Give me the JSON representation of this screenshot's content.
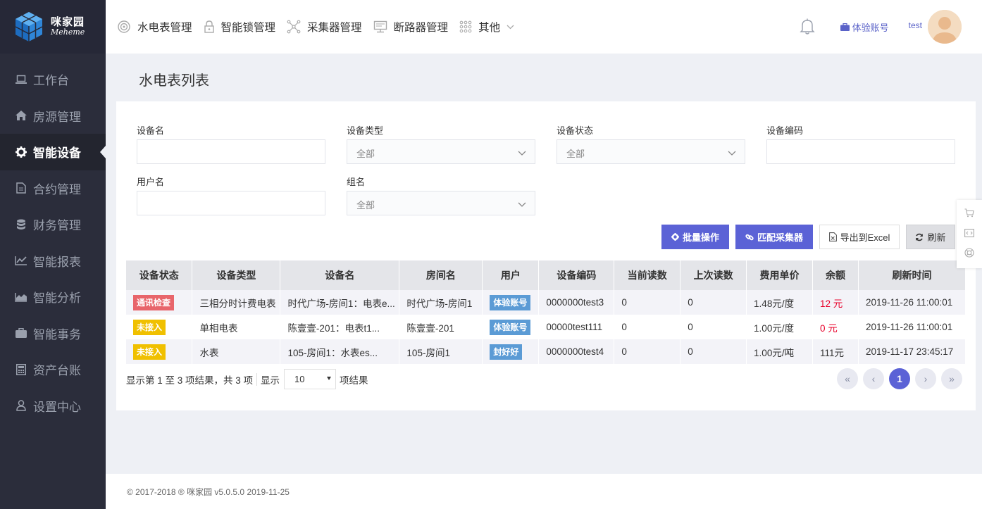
{
  "brand": {
    "name_cn": "咪家园",
    "name_en": "Meheme"
  },
  "sidebar": {
    "items": [
      {
        "label": "工作台",
        "icon": "laptop-icon"
      },
      {
        "label": "房源管理",
        "icon": "home-icon"
      },
      {
        "label": "智能设备",
        "icon": "gear-icon",
        "active": true
      },
      {
        "label": "合约管理",
        "icon": "document-icon"
      },
      {
        "label": "财务管理",
        "icon": "database-icon"
      },
      {
        "label": "智能报表",
        "icon": "line-chart-icon"
      },
      {
        "label": "智能分析",
        "icon": "area-chart-icon"
      },
      {
        "label": "智能事务",
        "icon": "briefcase-icon"
      },
      {
        "label": "资产台账",
        "icon": "calculator-icon"
      },
      {
        "label": "设置中心",
        "icon": "user-icon"
      }
    ]
  },
  "topnav": {
    "items": [
      {
        "label": "水电表管理",
        "icon": "meter-icon"
      },
      {
        "label": "智能锁管理",
        "icon": "lock-icon"
      },
      {
        "label": "采集器管理",
        "icon": "network-icon"
      },
      {
        "label": "断路器管理",
        "icon": "monitor-icon"
      },
      {
        "label": "其他",
        "icon": "grid-icon"
      }
    ],
    "trial_account": "体验账号",
    "username": "test"
  },
  "page": {
    "title": "水电表列表"
  },
  "filters": {
    "device_name": {
      "label": "设备名",
      "value": ""
    },
    "device_type": {
      "label": "设备类型",
      "value": "全部"
    },
    "device_status": {
      "label": "设备状态",
      "value": "全部"
    },
    "device_code": {
      "label": "设备编码",
      "value": ""
    },
    "user_name": {
      "label": "用户名",
      "value": ""
    },
    "group_name": {
      "label": "组名",
      "value": "全部"
    }
  },
  "actions": {
    "batch": "批量操作",
    "match": "匹配采集器",
    "export": "导出到Excel",
    "refresh": "刷新"
  },
  "table": {
    "headers": [
      "设备状态",
      "设备类型",
      "设备名",
      "房间名",
      "用户",
      "设备编码",
      "当前读数",
      "上次读数",
      "费用单价",
      "余额",
      "刷新时间"
    ],
    "rows": [
      {
        "status": "通讯检查",
        "status_color": "#e8656b",
        "type": "三相分时计费电表",
        "name": "时代广场-房间1：电表e...",
        "room": "时代广场-房间1",
        "user": "体验账号",
        "code": "0000000test3",
        "current": "0",
        "last": "0",
        "price": "1.48元/度",
        "balance": "12 元",
        "balance_red": true,
        "time": "2019-11-26 11:00:01"
      },
      {
        "status": "未接入",
        "status_color": "#f0c000",
        "type": "单相电表",
        "name": "陈壹壹-201：电表t1...",
        "room": "陈壹壹-201",
        "user": "体验账号",
        "code": "00000test111",
        "current": "0",
        "last": "0",
        "price": "1.00元/度",
        "balance": "0 元",
        "balance_red": true,
        "time": "2019-11-26 11:00:01"
      },
      {
        "status": "未接入",
        "status_color": "#f0c000",
        "type": "水表",
        "name": "105-房间1：水表es...",
        "room": "105-房间1",
        "user": "封好好",
        "code": "0000000test4",
        "current": "0",
        "last": "0",
        "price": "1.00元/吨",
        "balance": "111元",
        "balance_red": false,
        "time": "2019-11-17 23:45:17"
      }
    ],
    "user_badge_color": "#5b9bd5"
  },
  "pagination": {
    "summary": "显示第 1 至 3 项结果，共 3 项",
    "show_label": "显示",
    "page_size": "10",
    "result_label": "项结果",
    "first": "«",
    "prev": "‹",
    "current": "1",
    "next": "›",
    "last": "»"
  },
  "footer": {
    "text": "© 2017-2018 ® 咪家园 v5.0.5.0 2019-11-25"
  }
}
